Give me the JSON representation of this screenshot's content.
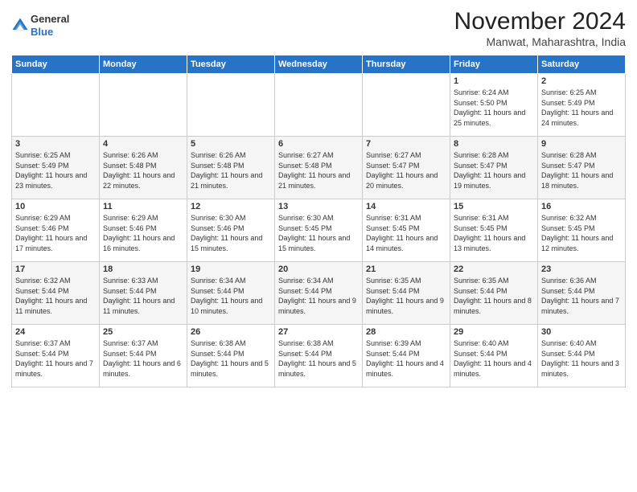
{
  "logo": {
    "general": "General",
    "blue": "Blue"
  },
  "title": "November 2024",
  "subtitle": "Manwat, Maharashtra, India",
  "headers": [
    "Sunday",
    "Monday",
    "Tuesday",
    "Wednesday",
    "Thursday",
    "Friday",
    "Saturday"
  ],
  "weeks": [
    [
      {
        "day": "",
        "text": ""
      },
      {
        "day": "",
        "text": ""
      },
      {
        "day": "",
        "text": ""
      },
      {
        "day": "",
        "text": ""
      },
      {
        "day": "",
        "text": ""
      },
      {
        "day": "1",
        "text": "Sunrise: 6:24 AM\nSunset: 5:50 PM\nDaylight: 11 hours and 25 minutes."
      },
      {
        "day": "2",
        "text": "Sunrise: 6:25 AM\nSunset: 5:49 PM\nDaylight: 11 hours and 24 minutes."
      }
    ],
    [
      {
        "day": "3",
        "text": "Sunrise: 6:25 AM\nSunset: 5:49 PM\nDaylight: 11 hours and 23 minutes."
      },
      {
        "day": "4",
        "text": "Sunrise: 6:26 AM\nSunset: 5:48 PM\nDaylight: 11 hours and 22 minutes."
      },
      {
        "day": "5",
        "text": "Sunrise: 6:26 AM\nSunset: 5:48 PM\nDaylight: 11 hours and 21 minutes."
      },
      {
        "day": "6",
        "text": "Sunrise: 6:27 AM\nSunset: 5:48 PM\nDaylight: 11 hours and 21 minutes."
      },
      {
        "day": "7",
        "text": "Sunrise: 6:27 AM\nSunset: 5:47 PM\nDaylight: 11 hours and 20 minutes."
      },
      {
        "day": "8",
        "text": "Sunrise: 6:28 AM\nSunset: 5:47 PM\nDaylight: 11 hours and 19 minutes."
      },
      {
        "day": "9",
        "text": "Sunrise: 6:28 AM\nSunset: 5:47 PM\nDaylight: 11 hours and 18 minutes."
      }
    ],
    [
      {
        "day": "10",
        "text": "Sunrise: 6:29 AM\nSunset: 5:46 PM\nDaylight: 11 hours and 17 minutes."
      },
      {
        "day": "11",
        "text": "Sunrise: 6:29 AM\nSunset: 5:46 PM\nDaylight: 11 hours and 16 minutes."
      },
      {
        "day": "12",
        "text": "Sunrise: 6:30 AM\nSunset: 5:46 PM\nDaylight: 11 hours and 15 minutes."
      },
      {
        "day": "13",
        "text": "Sunrise: 6:30 AM\nSunset: 5:45 PM\nDaylight: 11 hours and 15 minutes."
      },
      {
        "day": "14",
        "text": "Sunrise: 6:31 AM\nSunset: 5:45 PM\nDaylight: 11 hours and 14 minutes."
      },
      {
        "day": "15",
        "text": "Sunrise: 6:31 AM\nSunset: 5:45 PM\nDaylight: 11 hours and 13 minutes."
      },
      {
        "day": "16",
        "text": "Sunrise: 6:32 AM\nSunset: 5:45 PM\nDaylight: 11 hours and 12 minutes."
      }
    ],
    [
      {
        "day": "17",
        "text": "Sunrise: 6:32 AM\nSunset: 5:44 PM\nDaylight: 11 hours and 11 minutes."
      },
      {
        "day": "18",
        "text": "Sunrise: 6:33 AM\nSunset: 5:44 PM\nDaylight: 11 hours and 11 minutes."
      },
      {
        "day": "19",
        "text": "Sunrise: 6:34 AM\nSunset: 5:44 PM\nDaylight: 11 hours and 10 minutes."
      },
      {
        "day": "20",
        "text": "Sunrise: 6:34 AM\nSunset: 5:44 PM\nDaylight: 11 hours and 9 minutes."
      },
      {
        "day": "21",
        "text": "Sunrise: 6:35 AM\nSunset: 5:44 PM\nDaylight: 11 hours and 9 minutes."
      },
      {
        "day": "22",
        "text": "Sunrise: 6:35 AM\nSunset: 5:44 PM\nDaylight: 11 hours and 8 minutes."
      },
      {
        "day": "23",
        "text": "Sunrise: 6:36 AM\nSunset: 5:44 PM\nDaylight: 11 hours and 7 minutes."
      }
    ],
    [
      {
        "day": "24",
        "text": "Sunrise: 6:37 AM\nSunset: 5:44 PM\nDaylight: 11 hours and 7 minutes."
      },
      {
        "day": "25",
        "text": "Sunrise: 6:37 AM\nSunset: 5:44 PM\nDaylight: 11 hours and 6 minutes."
      },
      {
        "day": "26",
        "text": "Sunrise: 6:38 AM\nSunset: 5:44 PM\nDaylight: 11 hours and 5 minutes."
      },
      {
        "day": "27",
        "text": "Sunrise: 6:38 AM\nSunset: 5:44 PM\nDaylight: 11 hours and 5 minutes."
      },
      {
        "day": "28",
        "text": "Sunrise: 6:39 AM\nSunset: 5:44 PM\nDaylight: 11 hours and 4 minutes."
      },
      {
        "day": "29",
        "text": "Sunrise: 6:40 AM\nSunset: 5:44 PM\nDaylight: 11 hours and 4 minutes."
      },
      {
        "day": "30",
        "text": "Sunrise: 6:40 AM\nSunset: 5:44 PM\nDaylight: 11 hours and 3 minutes."
      }
    ]
  ]
}
